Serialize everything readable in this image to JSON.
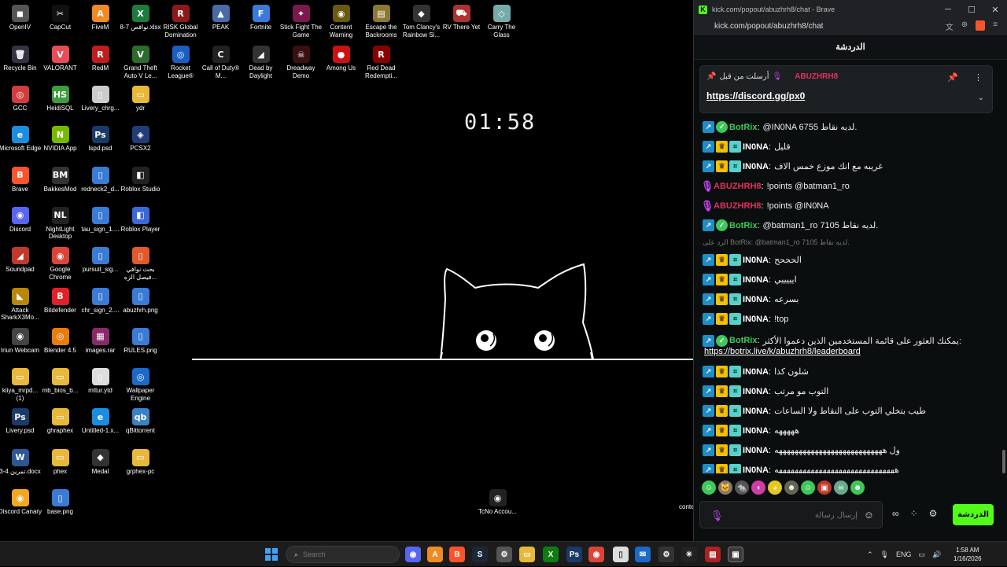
{
  "desktop": {
    "icons": [
      {
        "label": "OpenIV",
        "glyph": "◼",
        "color": "#555"
      },
      {
        "label": "CapCut",
        "glyph": "✂",
        "color": "#111"
      },
      {
        "label": "FiveM",
        "glyph": "A",
        "color": "#f08a24"
      },
      {
        "label": "نواقص 7-8.xlsx",
        "glyph": "X",
        "color": "#1f7a3d"
      },
      {
        "label": "RISK Global Domination",
        "glyph": "R",
        "color": "#8b1a1a"
      },
      {
        "label": "PEAK",
        "glyph": "▲",
        "color": "#4a6aa8"
      },
      {
        "label": "Fortnite",
        "glyph": "F",
        "color": "#3b7ad9"
      },
      {
        "label": "Stick Fight The Game",
        "glyph": "✦",
        "color": "#7a1a4a"
      },
      {
        "label": "Content Warning",
        "glyph": "◉",
        "color": "#6a5a10"
      },
      {
        "label": "Escape the Backrooms",
        "glyph": "▤",
        "color": "#8a7a30"
      },
      {
        "label": "Tom Clancy's Rainbow Si...",
        "glyph": "◆",
        "color": "#333"
      },
      {
        "label": "RV There Yet",
        "glyph": "⛟",
        "color": "#a33"
      },
      {
        "label": "Carry The Glass",
        "glyph": "◇",
        "color": "#7aa"
      },
      {
        "label": "Recycle Bin",
        "glyph": "🗑",
        "color": "#334"
      },
      {
        "label": "VALORANT",
        "glyph": "V",
        "color": "#e94b58"
      },
      {
        "label": "RedM",
        "glyph": "R",
        "color": "#c21c1c"
      },
      {
        "label": "Grand Theft Auto V Le...",
        "glyph": "V",
        "color": "#2e6b2e"
      },
      {
        "label": "Rocket League®",
        "glyph": "◎",
        "color": "#1b5fc4"
      },
      {
        "label": "Call of Duty® M...",
        "glyph": "C",
        "color": "#222"
      },
      {
        "label": "Dead by Daylight",
        "glyph": "◢",
        "color": "#333"
      },
      {
        "label": "Dreadway Demo",
        "glyph": "☠",
        "color": "#3a1010"
      },
      {
        "label": "Among Us",
        "glyph": "●",
        "color": "#c11"
      },
      {
        "label": "Red Dead Redempti...",
        "glyph": "R",
        "color": "#8b0000"
      },
      {
        "label": "GCC",
        "glyph": "◎",
        "color": "#d23c3c"
      },
      {
        "label": "HeidiSQL",
        "glyph": "HS",
        "color": "#3e9e3e"
      },
      {
        "label": "Livery_chrg...",
        "glyph": "▯",
        "color": "#ccc"
      },
      {
        "label": "ydr",
        "glyph": "▭",
        "color": "#e8b83a"
      },
      {
        "label": "Microsoft Edge",
        "glyph": "e",
        "color": "#1b8de0"
      },
      {
        "label": "NVIDIA App",
        "glyph": "N",
        "color": "#76b900"
      },
      {
        "label": "lspd.psd",
        "glyph": "Ps",
        "color": "#1a3a6a"
      },
      {
        "label": "PCSX2",
        "glyph": "◈",
        "color": "#223c7a"
      },
      {
        "label": "Brave",
        "glyph": "B",
        "color": "#fb542b"
      },
      {
        "label": "BakkesMod",
        "glyph": "BM",
        "color": "#333"
      },
      {
        "label": "redneck2_d...",
        "glyph": "▯",
        "color": "#3a7bd5"
      },
      {
        "label": "Roblox Studio",
        "glyph": "◧",
        "color": "#222"
      },
      {
        "label": "Discord",
        "glyph": "◉",
        "color": "#5865f2"
      },
      {
        "label": "NightLight Desktop",
        "glyph": "NL",
        "color": "#222"
      },
      {
        "label": "tau_sign_1....",
        "glyph": "▯",
        "color": "#3a7bd5"
      },
      {
        "label": "Roblox Player",
        "glyph": "◧",
        "color": "#3a68d8"
      },
      {
        "label": "Soundpad",
        "glyph": "◢",
        "color": "#c0392b"
      },
      {
        "label": "Google Chrome",
        "glyph": "◉",
        "color": "#db4437"
      },
      {
        "label": "pursuit_sig...",
        "glyph": "▯",
        "color": "#3a7bd5"
      },
      {
        "label": "بحث نوافي فيصل الزه...",
        "glyph": "▯",
        "color": "#e05a2b"
      },
      {
        "label": "Attack SharkX3Mo...",
        "glyph": "◣",
        "color": "#b8860b"
      },
      {
        "label": "Bitdefender",
        "glyph": "B",
        "color": "#e3202a"
      },
      {
        "label": "chr_sign_2....",
        "glyph": "▯",
        "color": "#3a7bd5"
      },
      {
        "label": "abuzhrh.png",
        "glyph": "▯",
        "color": "#3a7bd5"
      },
      {
        "label": "Iriun Webcam",
        "glyph": "◉",
        "color": "#444"
      },
      {
        "label": "Blender 4.5",
        "glyph": "◎",
        "color": "#e87d0d"
      },
      {
        "label": "images.rar",
        "glyph": "▦",
        "color": "#8a2a6a"
      },
      {
        "label": "RULES.png",
        "glyph": "▯",
        "color": "#3a7bd5"
      },
      {
        "label": "kiiya_mrpd... (1)",
        "glyph": "▭",
        "color": "#e8b83a"
      },
      {
        "label": "mb_bios_b...",
        "glyph": "▭",
        "color": "#e8b83a"
      },
      {
        "label": "mttur.ytd",
        "glyph": "▯",
        "color": "#ddd"
      },
      {
        "label": "Wallpaper Engine",
        "glyph": "◎",
        "color": "#1b6ac8"
      },
      {
        "label": "Livery.psd",
        "glyph": "Ps",
        "color": "#1a3a6a"
      },
      {
        "label": "ghraphex",
        "glyph": "▭",
        "color": "#e8b83a"
      },
      {
        "label": "Untitled-1.x...",
        "glyph": "e",
        "color": "#1b8de0"
      },
      {
        "label": "qBittorrent",
        "glyph": "qb",
        "color": "#3b82c4"
      },
      {
        "label": "تمرين 4-3.docx",
        "glyph": "W",
        "color": "#2b5797"
      },
      {
        "label": "phex",
        "glyph": "▭",
        "color": "#e8b83a"
      },
      {
        "label": "Medal",
        "glyph": "◆",
        "color": "#333"
      },
      {
        "label": "grphex-pc",
        "glyph": "▭",
        "color": "#e8b83a"
      },
      {
        "label": "Discord Canary",
        "glyph": "◉",
        "color": "#f5a623"
      },
      {
        "label": "base.png",
        "glyph": "▯",
        "color": "#3a7bd5"
      },
      {
        "label": "TcNo Accou...",
        "glyph": "◉",
        "color": "#222"
      }
    ],
    "timer": "01:58",
    "partial_label": "conte"
  },
  "browser": {
    "title": "kick.com/popout/abuzhrh8/chat - Brave",
    "url": "kick.com/popout/abuzhrh8/chat",
    "chat_header": "الدردشة",
    "pinned": {
      "header": "أرسلت من قبل",
      "user": "ABUZHRH8",
      "link": "https://discord.gg/px0"
    },
    "messages": [
      {
        "user": "BotRix",
        "badges": [
          "arrow",
          "check"
        ],
        "type": "bot",
        "text": "@IN0NA 6755 لديه نقاط."
      },
      {
        "user": "IN0NA",
        "badges": [
          "arrow",
          "crown",
          "sub"
        ],
        "type": "in",
        "text": "قليل"
      },
      {
        "user": "IN0NA",
        "badges": [
          "arrow",
          "crown",
          "sub"
        ],
        "type": "in",
        "text": "غريبه مع انك موزع خمس الاف"
      },
      {
        "user": "ABUZHRH8",
        "badges": [
          "mic"
        ],
        "type": "ab",
        "text": "!points @batman1_ro"
      },
      {
        "user": "ABUZHRH8",
        "badges": [
          "mic"
        ],
        "type": "ab",
        "text": "!points @IN0NA"
      },
      {
        "user": "BotRix",
        "badges": [
          "arrow",
          "check"
        ],
        "type": "bot",
        "text": "@batman1_ro 7105 لديه نقاط."
      },
      {
        "reply": "الرد على BotRix: @batman1_ro 7105 لديه نقاط."
      },
      {
        "user": "IN0NA",
        "badges": [
          "arrow",
          "crown",
          "sub"
        ],
        "type": "in",
        "text": "الحححح"
      },
      {
        "user": "IN0NA",
        "badges": [
          "arrow",
          "crown",
          "sub"
        ],
        "type": "in",
        "text": "ايييييي"
      },
      {
        "user": "IN0NA",
        "badges": [
          "arrow",
          "crown",
          "sub"
        ],
        "type": "in",
        "text": "بسرعه"
      },
      {
        "user": "IN0NA",
        "badges": [
          "arrow",
          "crown",
          "sub"
        ],
        "type": "in",
        "text": "!top"
      },
      {
        "user": "BotRix",
        "badges": [
          "arrow",
          "check"
        ],
        "type": "bot",
        "text": "يمكنك العثور على قائمة المستخدمين الذين دعموا الأكثر:",
        "link": "https://botrix.live/k/abuzhrh8/leaderboard"
      },
      {
        "user": "IN0NA",
        "badges": [
          "arrow",
          "crown",
          "sub"
        ],
        "type": "in",
        "text": "شلون كذا"
      },
      {
        "user": "IN0NA",
        "badges": [
          "arrow",
          "crown",
          "sub"
        ],
        "type": "in",
        "text": "التوب مو مرتب"
      },
      {
        "user": "IN0NA",
        "badges": [
          "arrow",
          "crown",
          "sub"
        ],
        "type": "in",
        "text": "طيب بتخلي التوب على النقاط ولا الساعات"
      },
      {
        "user": "IN0NA",
        "badges": [
          "arrow",
          "crown",
          "sub"
        ],
        "type": "in",
        "text": "هههههه"
      },
      {
        "user": "IN0NA",
        "badges": [
          "arrow",
          "crown",
          "sub"
        ],
        "type": "in",
        "text": "ول هههههههههههههههههههههههههههه"
      },
      {
        "user": "IN0NA",
        "badges": [
          "arrow",
          "crown",
          "sub"
        ],
        "type": "in",
        "text": "ههههههههههههههههههههههههههههههه"
      }
    ],
    "input_placeholder": "إرسال رسالة",
    "send_label": "الدردشة"
  },
  "taskbar": {
    "search_placeholder": "Search",
    "lang": "ENG",
    "time": "1:58 AM",
    "date": "1/16/2026"
  }
}
